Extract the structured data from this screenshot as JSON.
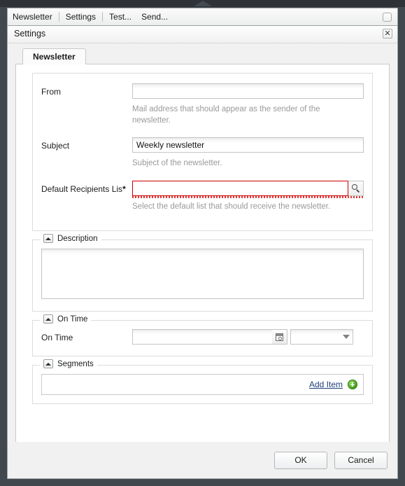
{
  "menubar": {
    "items": [
      {
        "label": "Newsletter"
      },
      {
        "label": "Settings"
      },
      {
        "label": "Test..."
      },
      {
        "label": "Send..."
      }
    ],
    "toggle_name": "checkbox-toggle"
  },
  "dialog": {
    "title": "Settings",
    "close_label": "✕"
  },
  "tabs": [
    {
      "label": "Newsletter",
      "active": true
    }
  ],
  "form": {
    "from": {
      "label": "From",
      "value": "",
      "placeholder": "",
      "hint": "Mail address that should appear as the sender of the newsletter."
    },
    "subject": {
      "label": "Subject",
      "value": "Weekly newsletter",
      "placeholder": "",
      "hint": "Subject of the newsletter."
    },
    "recipients": {
      "label": "Default Recipients Lis",
      "required_marker": "*",
      "value": "",
      "placeholder": "",
      "hint": "Select the default list that should receive the newsletter.",
      "lookup_icon": "search-icon",
      "error": true,
      "error_color": "#cc0000"
    }
  },
  "panels": {
    "description": {
      "legend": "Description",
      "value": "",
      "placeholder": "",
      "collapse_icon": "chevron-up-icon"
    },
    "on_time": {
      "legend": "On Time",
      "collapse_icon": "chevron-up-icon",
      "field_label": "On Time",
      "date_value": "",
      "date_placeholder": "",
      "date_icon": "calendar-icon",
      "time_value": "",
      "time_icon": "chevron-down-icon"
    },
    "segments": {
      "legend": "Segments",
      "collapse_icon": "chevron-up-icon",
      "add_label": "Add Item",
      "add_icon": "plus-circle-icon"
    }
  },
  "footer": {
    "ok_label": "OK",
    "cancel_label": "Cancel"
  },
  "colors": {
    "window_bg": "#41494e",
    "titlebar": "#2f3337",
    "dialog_bg": "#f1f1f1",
    "body_bg": "#ffffff",
    "link": "#1f3f7a",
    "error": "#cc0000",
    "hint": "#9a9a9a",
    "add_icon_green": "#43a017"
  }
}
